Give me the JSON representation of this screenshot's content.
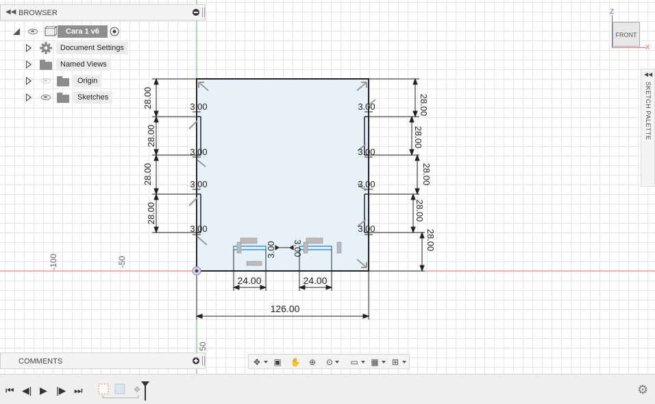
{
  "browser": {
    "title": "BROWSER",
    "root": {
      "name": "Cara 1 v6"
    },
    "items": [
      {
        "label": "Document Settings"
      },
      {
        "label": "Named Views"
      },
      {
        "label": "Origin"
      },
      {
        "label": "Sketches"
      }
    ]
  },
  "comments": {
    "title": "COMMENTS"
  },
  "viewcube": {
    "face": "FRONT",
    "axis_z": "Z",
    "axis_x": "X"
  },
  "sketch_palette": {
    "title": "SKETCH PALETTE"
  },
  "ruler": {
    "h1": "-100",
    "h2": "-50",
    "v1": "50"
  },
  "dimensions": {
    "left": [
      "28.00",
      "28.00",
      "28.00",
      "28.00"
    ],
    "right": [
      "28.00",
      "28.00",
      "28.00",
      "28.00",
      "28.00"
    ],
    "offsets": [
      "3.00",
      "3.00",
      "3.00",
      "3.00",
      "3.00",
      "3.00",
      "3.00",
      "3.00"
    ],
    "bottom_small": [
      "3.00",
      "3.00"
    ],
    "slot_widths": [
      "24.00",
      "24.00"
    ],
    "total_width": "126.00"
  },
  "colors": {
    "sketch_fill": "#e6f1fa",
    "profile_line": "#222222",
    "slot_blue": "#3d8fd6",
    "axis_red": "#e57373",
    "axis_green": "#5cc45c",
    "origin": "#4a3a8a"
  },
  "icons": {
    "browser_collapse": "double-left-arrow-icon",
    "settings": "gear-icon",
    "visibility": "eye-icon",
    "folder": "folder-icon",
    "component": "component-icon",
    "palette_collapse": "double-left-arrow-icon",
    "orbit": "orbit-icon",
    "look_at": "look-at-icon",
    "pan": "hand-icon",
    "zoom": "zoom-icon",
    "fit": "zoom-window-icon",
    "display": "display-settings-icon",
    "grid": "grid-icon",
    "viewports": "viewports-icon",
    "timeline_first": "skip-first-icon",
    "timeline_prev": "step-back-icon",
    "timeline_play": "play-icon",
    "timeline_next": "step-forward-icon",
    "timeline_last": "skip-last-icon",
    "timeline_settings": "gear-icon"
  }
}
